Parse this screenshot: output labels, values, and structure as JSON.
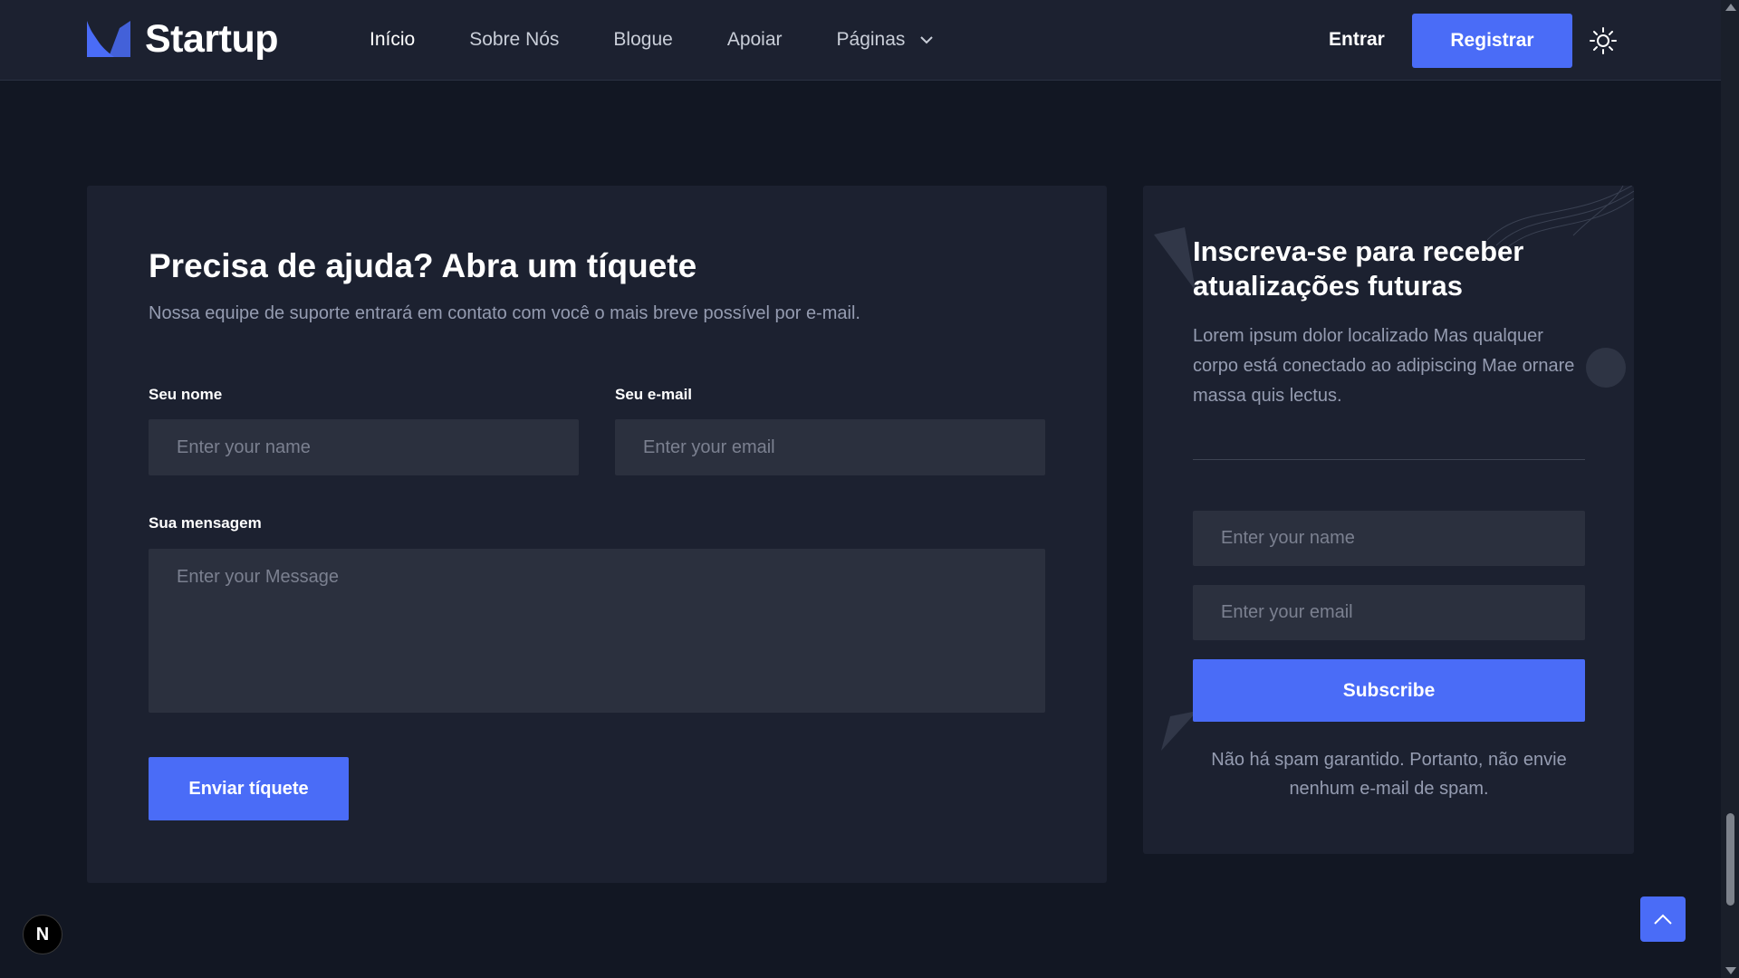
{
  "header": {
    "brand": "Startup",
    "nav": [
      {
        "label": "Início",
        "active": true
      },
      {
        "label": "Sobre Nós",
        "active": false
      },
      {
        "label": "Blogue",
        "active": false
      },
      {
        "label": "Apoiar",
        "active": false
      },
      {
        "label": "Páginas",
        "active": false,
        "has_dropdown": true
      }
    ],
    "signin_label": "Entrar",
    "register_label": "Registrar",
    "theme_icon": "sun-icon"
  },
  "ticket": {
    "title": "Precisa de ajuda? Abra um tíquete",
    "subtitle": "Nossa equipe de suporte entrará em contato com você o mais breve possível por e-mail.",
    "name_label": "Seu nome",
    "name_placeholder": "Enter your name",
    "email_label": "Seu e-mail",
    "email_placeholder": "Enter your email",
    "message_label": "Sua mensagem",
    "message_placeholder": "Enter your Message",
    "submit_label": "Enviar tíquete"
  },
  "newsletter": {
    "title": "Inscreva-se para receber atualizações futuras",
    "description": "Lorem ipsum dolor localizado Mas qualquer corpo está conectado ao adipiscing Mae ornare massa quis lectus.",
    "name_placeholder": "Enter your name",
    "email_placeholder": "Enter your email",
    "subscribe_label": "Subscribe",
    "note": "Não há spam garantido. Portanto, não envie nenhum e-mail de spam."
  },
  "floating": {
    "back_to_top_icon": "chevron-up-icon",
    "dev_badge": "N"
  },
  "colors": {
    "background": "#121723",
    "card": "#1c2130",
    "input": "#2b303e",
    "primary": "#4a6cf7",
    "muted_text": "#959cb1"
  }
}
